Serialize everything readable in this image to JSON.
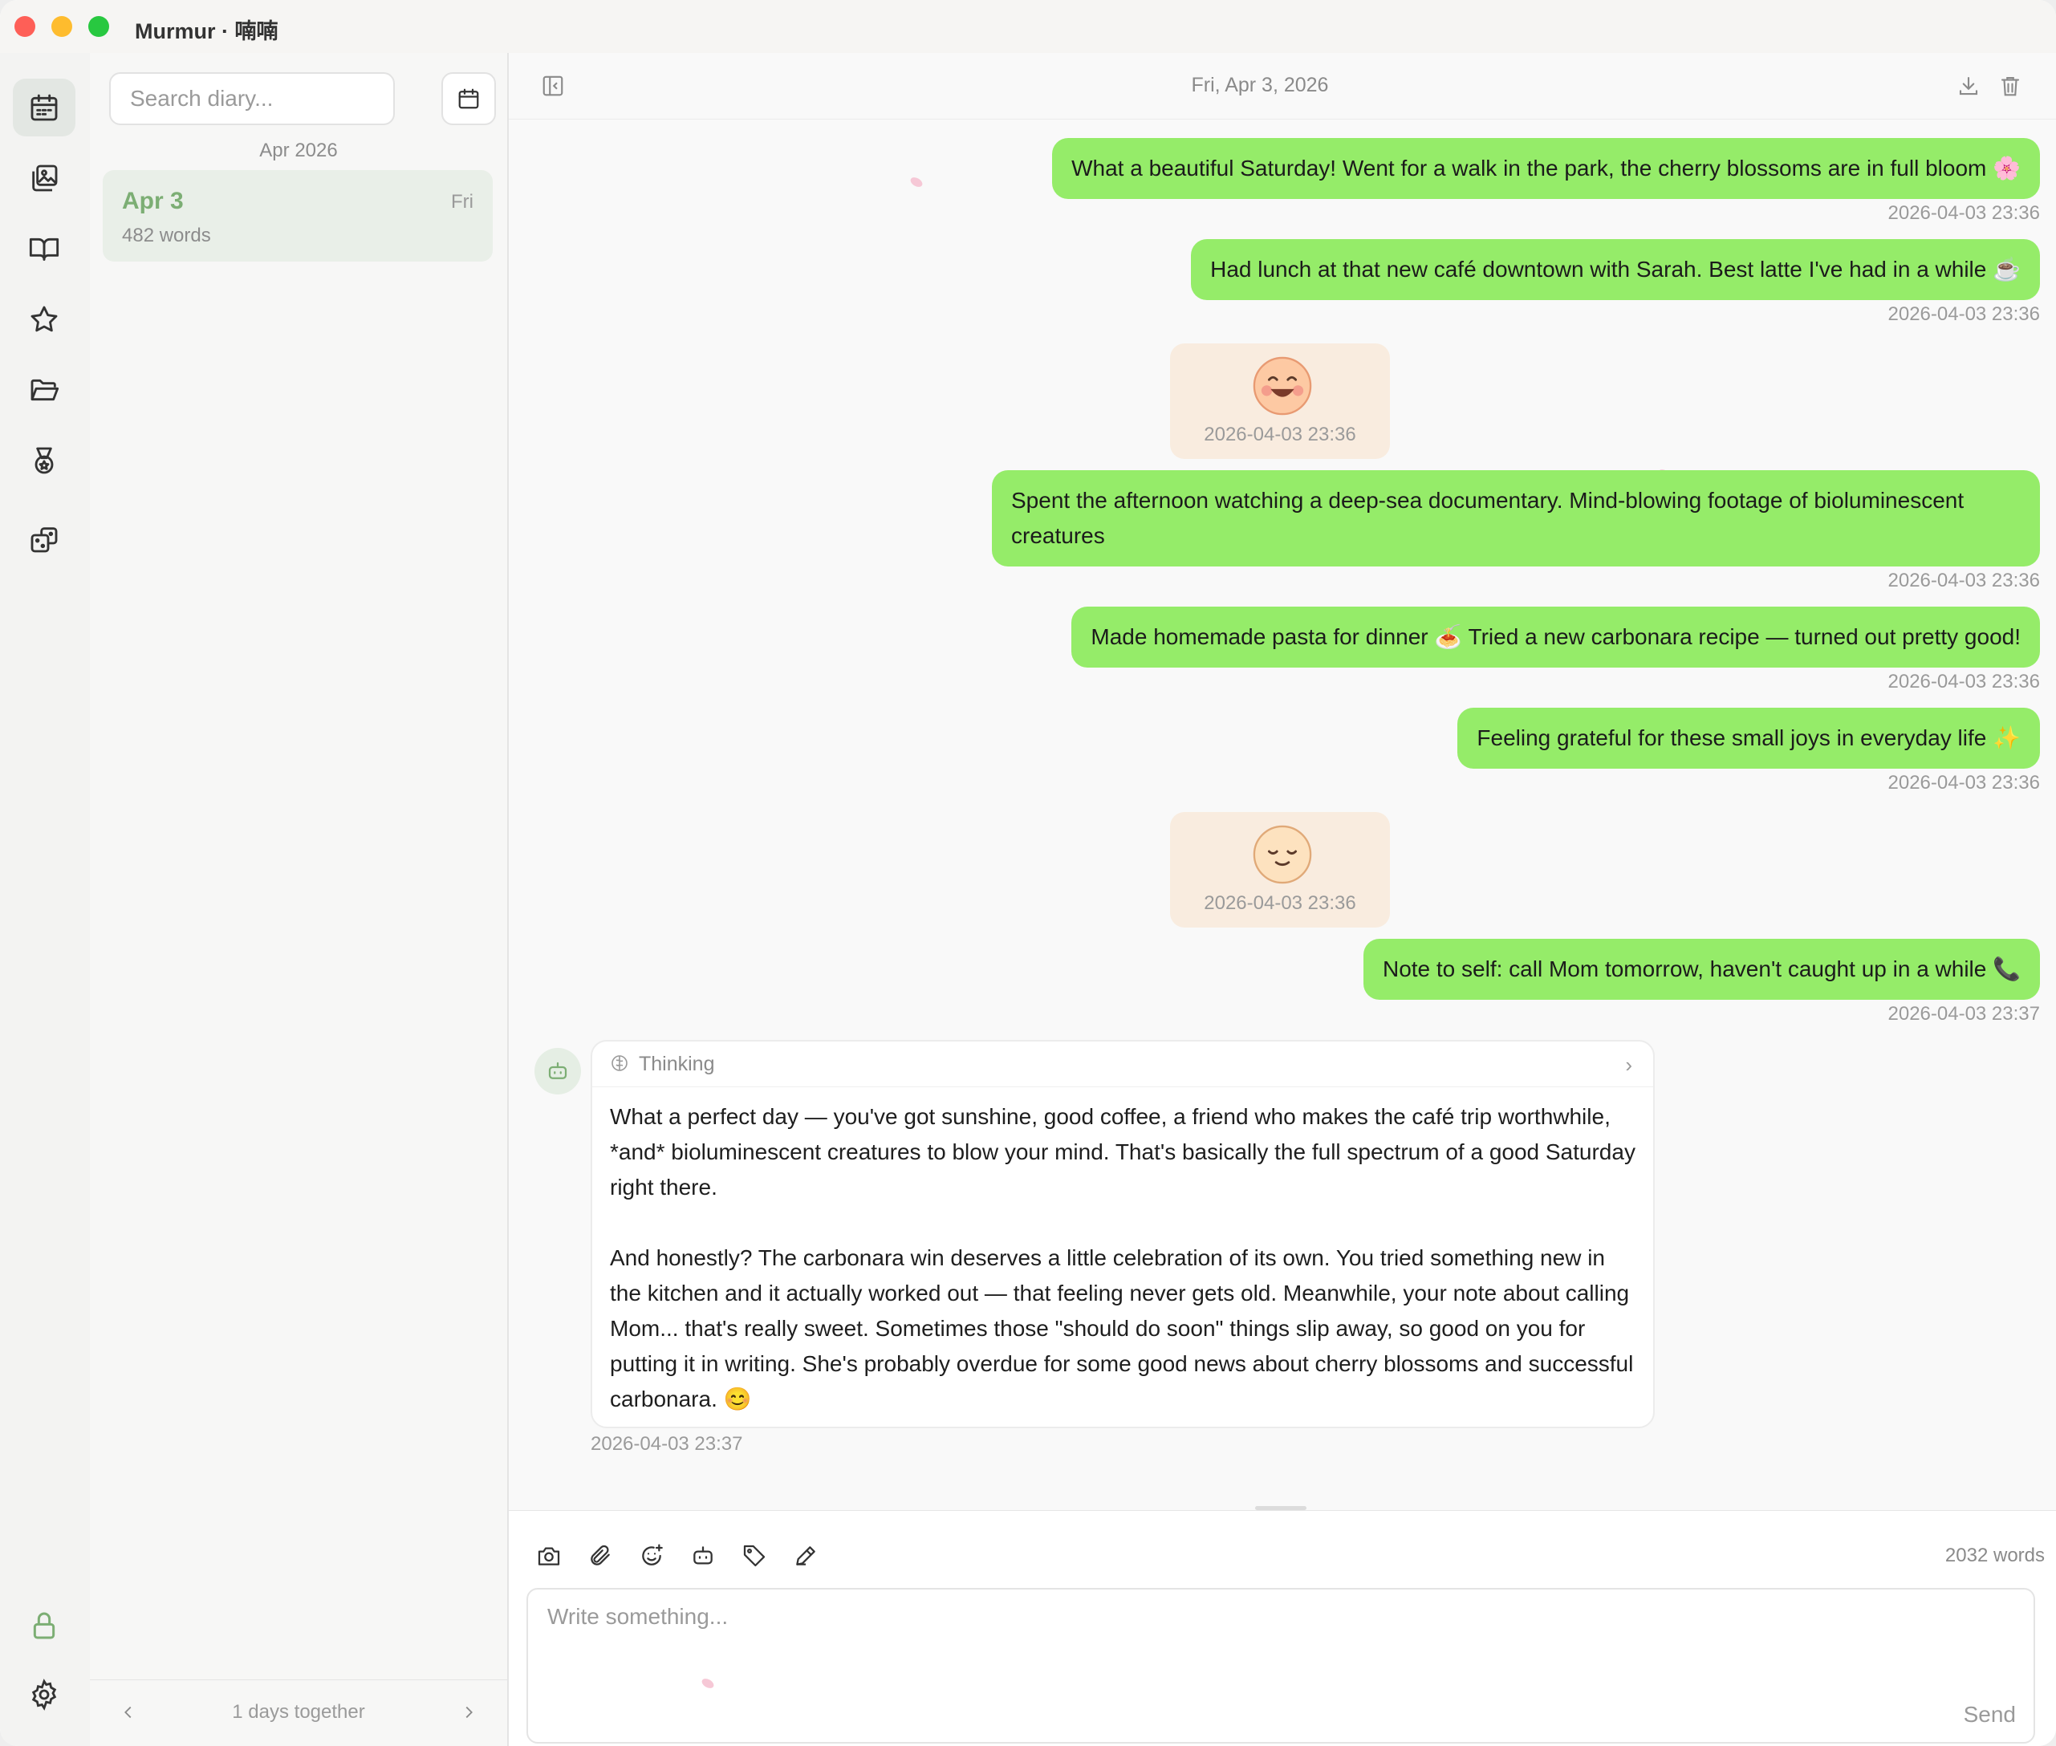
{
  "window": {
    "title": "Murmur · 喃喃"
  },
  "rail": {
    "items": [
      {
        "icon": "calendar-icon",
        "active": true
      },
      {
        "icon": "gallery-icon"
      },
      {
        "icon": "book-icon"
      },
      {
        "icon": "star-icon"
      },
      {
        "icon": "folder-icon"
      },
      {
        "icon": "medal-icon"
      },
      {
        "icon": "dice-icon"
      }
    ],
    "bottom": [
      {
        "icon": "lock-icon"
      },
      {
        "icon": "settings-icon"
      }
    ]
  },
  "sidebar": {
    "search_placeholder": "Search diary...",
    "month": "Apr 2026",
    "entries": [
      {
        "date": "Apr 3",
        "day": "Fri",
        "words": "482 words"
      }
    ],
    "footer": {
      "text": "1 days together"
    }
  },
  "main": {
    "header_date": "Fri, Apr 3, 2026",
    "messages": [
      {
        "text": "What a beautiful Saturday! Went for a walk in the park, the cherry blossoms are in full bloom 🌸",
        "time": "2026-04-03 23:36"
      },
      {
        "text": "Had lunch at that new café downtown with Sarah. Best latte I've had in a while ☕",
        "time": "2026-04-03 23:36"
      },
      {
        "mood": "grinning-face",
        "time": "2026-04-03 23:36"
      },
      {
        "text": "Spent the afternoon watching a deep-sea documentary. Mind-blowing footage of bioluminescent creatures",
        "time": "2026-04-03 23:36"
      },
      {
        "text": "Made homemade pasta for dinner 🍝 Tried a new carbonara recipe — turned out pretty good!",
        "time": "2026-04-03 23:36"
      },
      {
        "text": "Feeling grateful for these small joys in everyday life ✨",
        "time": "2026-04-03 23:36"
      },
      {
        "mood": "content-face",
        "time": "2026-04-03 23:36"
      },
      {
        "text": "Note to self: call Mom tomorrow, haven't caught up in a while 📞",
        "time": "2026-04-03 23:37"
      }
    ],
    "ai_reply": {
      "thinking_label": "Thinking",
      "paragraphs": [
        "What a perfect day — you've got sunshine, good coffee, a friend who makes the café trip worthwhile, *and* bioluminescent creatures to blow your mind. That's basically the full spectrum of a good Saturday right there.",
        "And honestly? The carbonara win deserves a little celebration of its own. You tried something new in the kitchen and it actually worked out — that feeling never gets old. Meanwhile, your note about calling Mom... that's really sweet. Sometimes those \"should do soon\" things slip away, so good on you for putting it in writing. She's probably overdue for some good news about cherry blossoms and successful carbonara. 😊"
      ],
      "time": "2026-04-03 23:37"
    }
  },
  "composer": {
    "tools": [
      "camera-icon",
      "paperclip-icon",
      "emoji-add-icon",
      "robot-icon",
      "tag-icon",
      "pen-icon"
    ],
    "word_count": "2032 words",
    "placeholder": "Write something...",
    "send_label": "Send"
  },
  "colors": {
    "bubble": "#95ec69",
    "accent": "#7cae74",
    "mood_bg": "#f9ecdf"
  }
}
